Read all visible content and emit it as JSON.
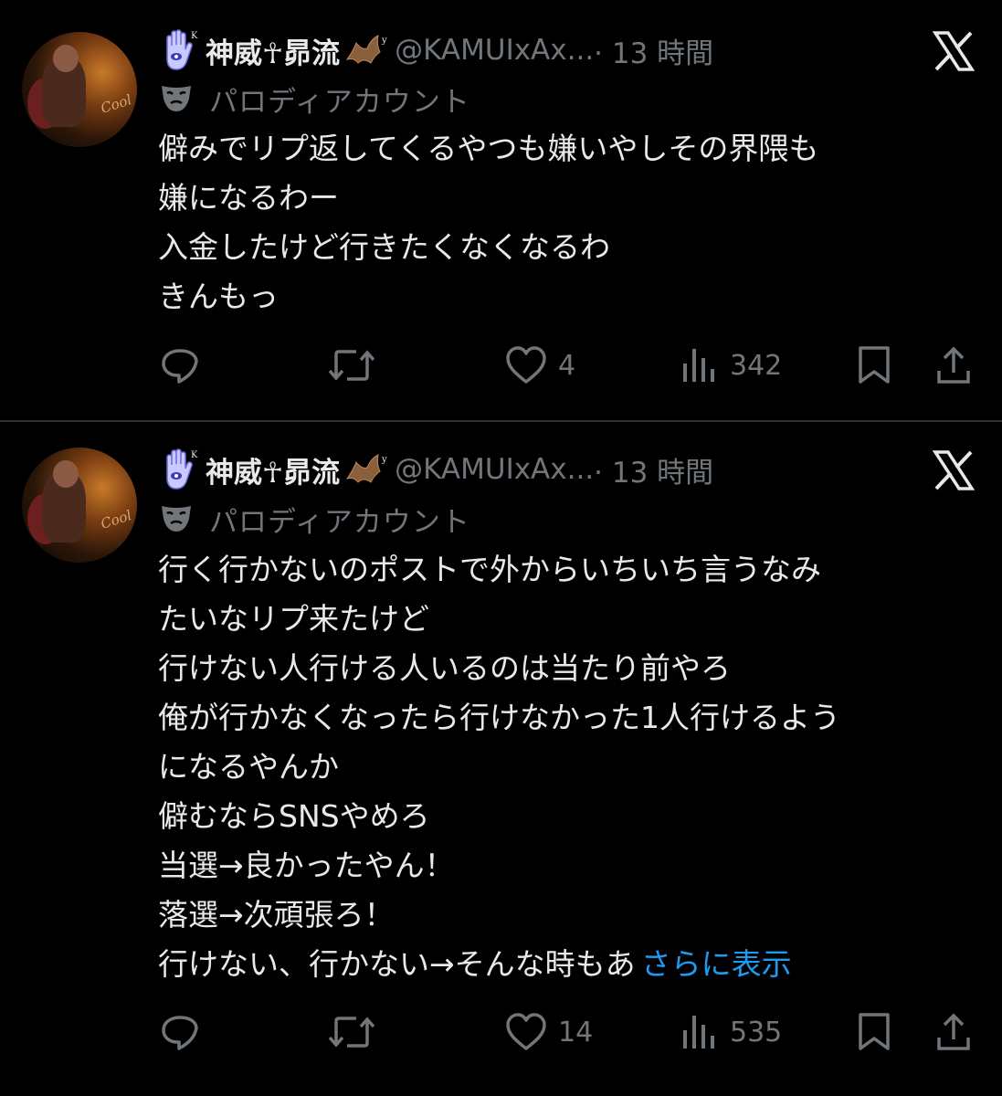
{
  "posts": [
    {
      "display_name": "神威☥昴流",
      "handle": "@KAMUIxAx...",
      "time": "· 13 時間",
      "parody_label": "パロディアカウント",
      "avatar_text": "Cool",
      "text_lines": [
        "僻みでリプ返してくるやつも嫌いやしその界隈も",
        "嫌になるわー",
        "入金したけど行きたくなくなるわ",
        "きんもっ"
      ],
      "likes": "4",
      "views": "342"
    },
    {
      "display_name": "神威☥昴流",
      "handle": "@KAMUIxAx...",
      "time": "· 13 時間",
      "parody_label": "パロディアカウント",
      "avatar_text": "Cool",
      "text_lines": [
        "行く行かないのポストで外からいちいち言うなみ",
        "たいなリプ来たけど",
        "行けない人行ける人いるのは当たり前やろ",
        "俺が行かなくなったら行けなかった1人行けるよう",
        "になるやんか",
        "僻むならSNSやめろ",
        "当選→良かったやん！",
        "落選→次頑張ろ！"
      ],
      "last_line": "行けない、行かない→そんな時もあ",
      "show_more": "さらに表示",
      "likes": "14",
      "views": "535"
    }
  ],
  "icons": [
    "hamsa-icon",
    "bat-icon",
    "x-logo-icon",
    "mask-icon",
    "reply-icon",
    "repost-icon",
    "like-icon",
    "views-icon",
    "bookmark-icon",
    "share-icon"
  ],
  "colors": {
    "background": "#000000",
    "text": "#e7e9ea",
    "muted": "#71767b",
    "link": "#1d9bf0",
    "divider": "#2f3336"
  }
}
